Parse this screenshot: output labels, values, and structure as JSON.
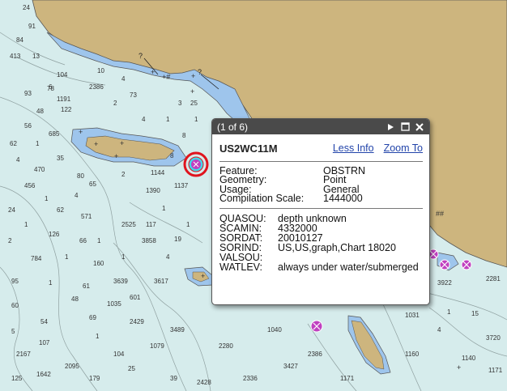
{
  "popup": {
    "counter": "(1 of 6)",
    "feature_id": "US2WC11M",
    "less_info": "Less Info",
    "zoom_to": "Zoom To",
    "general": [
      {
        "key": "Feature:",
        "value": "OBSTRN"
      },
      {
        "key": "Geometry:",
        "value": "Point"
      },
      {
        "key": "Usage:",
        "value": "General"
      },
      {
        "key": "Compilation Scale:",
        "value": "1444000"
      }
    ],
    "attributes": [
      {
        "key": "QUASOU:",
        "value": "depth unknown"
      },
      {
        "key": "SCAMIN:",
        "value": "4332000"
      },
      {
        "key": "SORDAT:",
        "value": "20010127"
      },
      {
        "key": "SORIND:",
        "value": "US,US,graph,Chart 18020"
      },
      {
        "key": "VALSOU:",
        "value": ""
      },
      {
        "key": "WATLEV:",
        "value": "always under water/submerged"
      }
    ]
  },
  "map": {
    "colors": {
      "water": "#d6ecec",
      "land": "#cdb57e",
      "shallow": "#9ec5ec",
      "selection": "#e0141e",
      "obstruction": "#c040c0"
    },
    "soundings": [
      "24",
      "91",
      "84",
      "413",
      "13",
      "104",
      "78",
      "93",
      "48",
      "122",
      "56",
      "685",
      "62",
      "35",
      "470",
      "80",
      "456",
      "4",
      "65",
      "62",
      "571",
      "24",
      "126",
      "784",
      "66",
      "160",
      "95",
      "1",
      "48",
      "61",
      "60",
      "54",
      "69",
      "5",
      "107",
      "1",
      "2167",
      "1642",
      "125",
      "2095",
      "179",
      "104",
      "25",
      "1079",
      "39",
      "1035",
      "2429",
      "3489",
      "2428",
      "2280",
      "2336",
      "1040",
      "3427",
      "2386",
      "1171",
      "1160",
      "4",
      "1140",
      "3720",
      "1171",
      "15",
      "1",
      "1031",
      "2281",
      "3922",
      "601",
      "3617",
      "3639",
      "3858",
      "4",
      "2525",
      "1",
      "1390",
      "1137",
      "2",
      "1144",
      "1",
      "19",
      "73",
      "2",
      "4",
      "1",
      "3",
      "1",
      "2386",
      "1191",
      "1",
      "4",
      "1",
      "2",
      "1",
      "1",
      "1",
      "1",
      "117",
      "8",
      "8",
      "25",
      "4",
      "10",
      "6",
      "5"
    ]
  }
}
